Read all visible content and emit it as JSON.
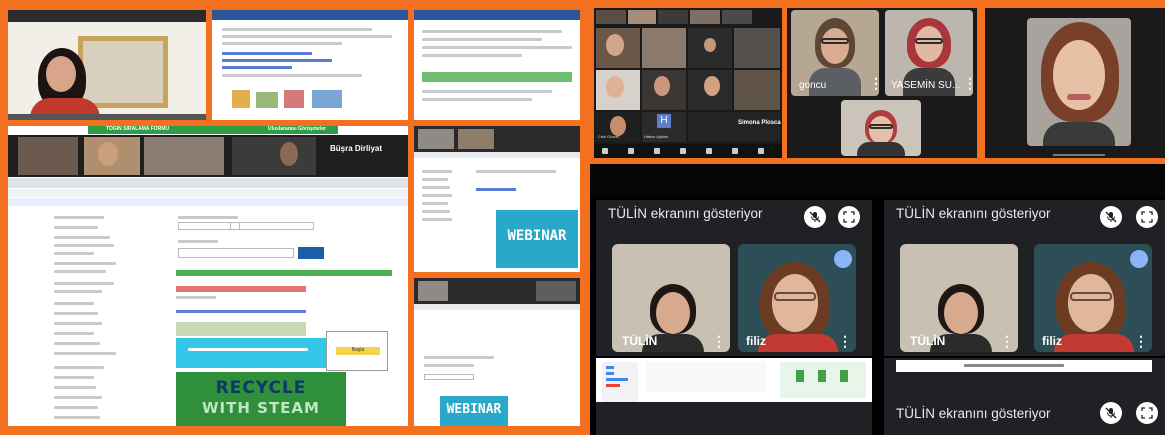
{
  "left_collage": {
    "banner_left": "TOGİN SIRALAMA FORMU",
    "banner_right": "Uluslararası Görüşmeler",
    "name_overlay": "Büşra Dirliyat",
    "recycle_line1": "RECYCLE",
    "recycle_line2": "WITH STEAM",
    "webinar_text": "WEBINAR",
    "webinar_text_small": "WEBINAR",
    "button_label": "Başla"
  },
  "top_grid": {
    "h_avatar": "H",
    "h_name": "Simona Ploscaru",
    "names": [
      "Ceki Gürsel",
      "Hatice Aybike",
      "Simona Plosca"
    ]
  },
  "zoom_speakers": {
    "left_name": "goncu",
    "right_name": "YASEMİN SU..."
  },
  "meet": {
    "banner": "TÜLİN ekranını gösteriyor",
    "banner_2": "TÜLİN ekranını gösteriyor",
    "banner_3": "TÜLİN ekranını gösteriyor",
    "name_a": "TÜLİN",
    "name_b": "filiz",
    "name_c": "TÜLİN",
    "name_d": "filiz"
  },
  "colors": {
    "frame_orange": "#f37021",
    "meet_bg": "#202124",
    "recycle_green": "#3a9b45"
  }
}
